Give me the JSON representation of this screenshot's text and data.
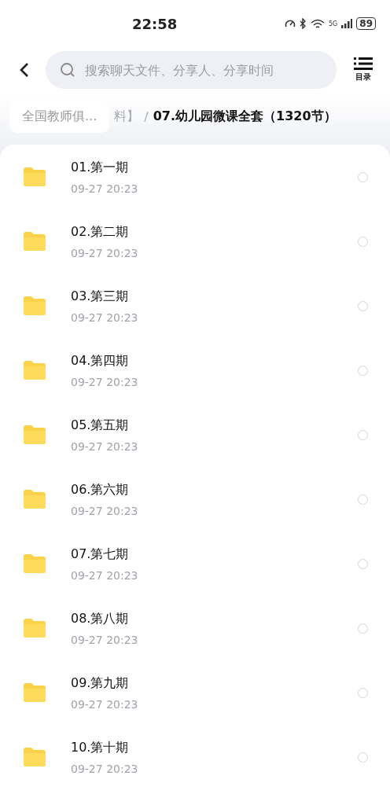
{
  "status_bar": {
    "time": "22:58",
    "network": "5G",
    "battery": "89"
  },
  "header": {
    "search": {
      "placeholder": "搜索聊天文件、分享人、分享时间"
    },
    "menu_label": "目录"
  },
  "breadcrumb": {
    "root": "全国教师俱...",
    "hidden_tail": "料】",
    "separator": "/",
    "current": "07.幼儿园微课全套（1320节）"
  },
  "files": [
    {
      "name": "01.第一期",
      "time": "09-27  20:23",
      "selected": false
    },
    {
      "name": "02.第二期",
      "time": "09-27  20:23",
      "selected": false
    },
    {
      "name": "03.第三期",
      "time": "09-27  20:23",
      "selected": false
    },
    {
      "name": "04.第四期",
      "time": "09-27  20:23",
      "selected": false
    },
    {
      "name": "05.第五期",
      "time": "09-27  20:23",
      "selected": false
    },
    {
      "name": "06.第六期",
      "time": "09-27  20:23",
      "selected": false
    },
    {
      "name": "07.第七期",
      "time": "09-27  20:23",
      "selected": false
    },
    {
      "name": "08.第八期",
      "time": "09-27  20:23",
      "selected": false
    },
    {
      "name": "09.第九期",
      "time": "09-27  20:23",
      "selected": false
    },
    {
      "name": "10.第十期",
      "time": "09-27  20:23",
      "selected": false
    }
  ]
}
